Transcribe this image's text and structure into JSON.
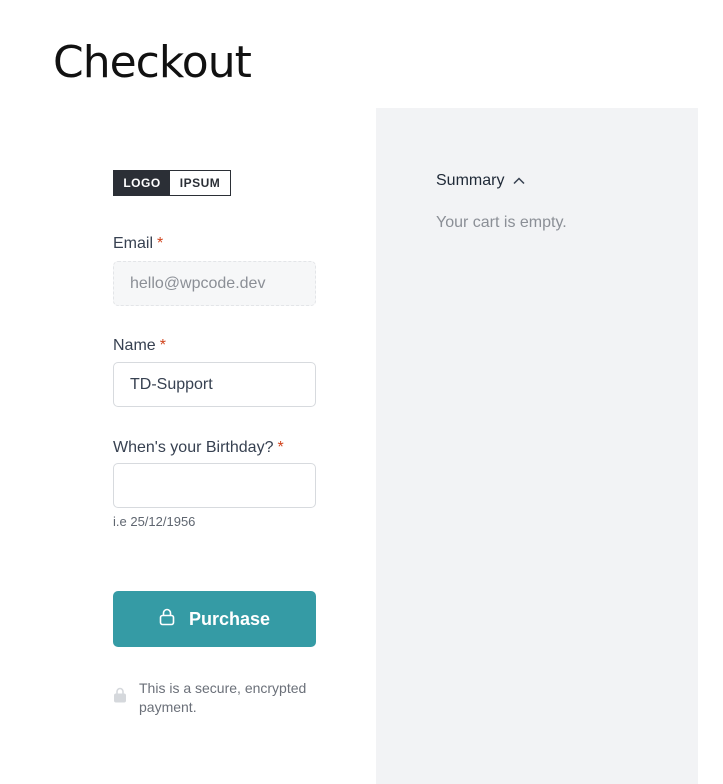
{
  "page": {
    "title": "Checkout"
  },
  "logo": {
    "left_text": "LOGO",
    "right_text": "IPSUM"
  },
  "form": {
    "email": {
      "label": "Email",
      "required_mark": "*",
      "value": "hello@wpcode.dev",
      "disabled": true
    },
    "name": {
      "label": "Name",
      "required_mark": "*",
      "value": "TD-Support"
    },
    "birthday": {
      "label": "When's your Birthday?",
      "required_mark": "*",
      "value": "",
      "hint": "i.e 25/12/1956"
    },
    "purchase_button": {
      "label": "Purchase",
      "icon": "lock-icon"
    },
    "secure_note": {
      "text": "This is a secure, encrypted payment.",
      "icon": "lock-icon"
    }
  },
  "summary": {
    "label": "Summary",
    "toggle_icon": "chevron-up-icon",
    "empty_text": "Your cart is empty."
  },
  "colors": {
    "accent": "#359ba5",
    "required": "#d0421b",
    "summary_bg": "#f2f3f5"
  }
}
